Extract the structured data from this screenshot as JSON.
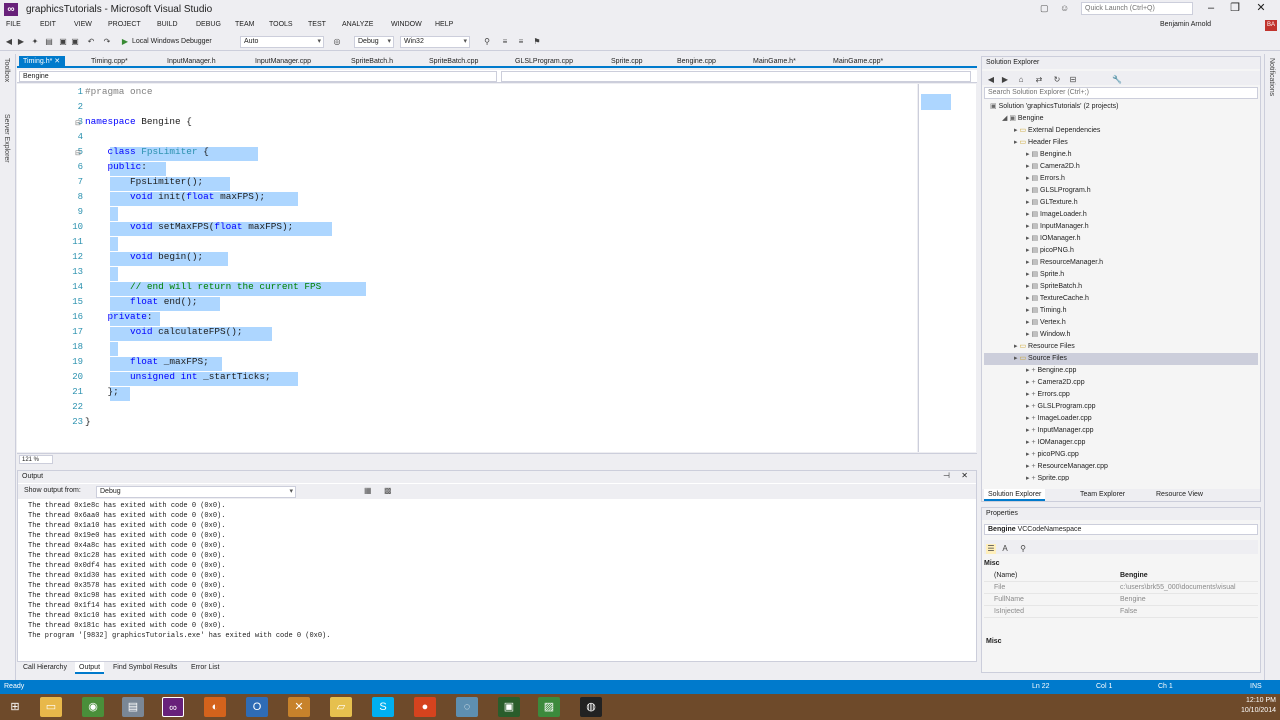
{
  "window": {
    "title": "graphicsTutorials - Microsoft Visual Studio",
    "quick_launch_placeholder": "Quick Launch (Ctrl+Q)",
    "user": "Benjamin Arnold",
    "avatar_initials": "BA"
  },
  "menu": [
    "FILE",
    "EDIT",
    "VIEW",
    "PROJECT",
    "BUILD",
    "DEBUG",
    "TEAM",
    "TOOLS",
    "TEST",
    "ANALYZE",
    "WINDOW",
    "HELP"
  ],
  "toolbar": {
    "debugger_label": "Local Windows Debugger",
    "debugger_mode": "Auto",
    "config": "Debug",
    "platform": "Win32"
  },
  "left_tabs": [
    "Toolbox",
    "Server Explorer"
  ],
  "right_tabs": [
    "Notifications"
  ],
  "doc_tabs": [
    "Timing.h*",
    "Timing.cpp*",
    "InputManager.h",
    "InputManager.cpp",
    "SpriteBatch.h",
    "SpriteBatch.cpp",
    "GLSLProgram.cpp",
    "Sprite.cpp",
    "Bengine.cpp",
    "MainGame.h*",
    "MainGame.cpp*"
  ],
  "nav": {
    "scope": "Bengine",
    "member": ""
  },
  "code_lines": [
    {
      "n": "1",
      "html": "<span class=\"pp\">#pragma once</span>"
    },
    {
      "n": "2",
      "html": ""
    },
    {
      "n": "3",
      "html": "<span class=\"kw\">namespace</span> Bengine {"
    },
    {
      "n": "4",
      "html": ""
    },
    {
      "n": "5",
      "html": "    <span class=\"kw\">class</span> <span class=\"ty\">FpsLimiter</span> {"
    },
    {
      "n": "6",
      "html": "    <span class=\"kw\">public</span>:"
    },
    {
      "n": "7",
      "html": "        FpsLimiter();"
    },
    {
      "n": "8",
      "html": "        <span class=\"kw\">void</span> init(<span class=\"kw\">float</span> maxFPS);"
    },
    {
      "n": "9",
      "html": ""
    },
    {
      "n": "10",
      "html": "        <span class=\"kw\">void</span> setMaxFPS(<span class=\"kw\">float</span> maxFPS);"
    },
    {
      "n": "11",
      "html": ""
    },
    {
      "n": "12",
      "html": "        <span class=\"kw\">void</span> begin();"
    },
    {
      "n": "13",
      "html": ""
    },
    {
      "n": "14",
      "html": "        <span class=\"cm\">// end will return the current FPS</span>"
    },
    {
      "n": "15",
      "html": "        <span class=\"kw\">float</span> end();"
    },
    {
      "n": "16",
      "html": "    <span class=\"kw\">private</span>:"
    },
    {
      "n": "17",
      "html": "        <span class=\"kw\">void</span> calculateFPS();"
    },
    {
      "n": "18",
      "html": ""
    },
    {
      "n": "19",
      "html": "        <span class=\"kw\">float</span> _maxFPS;"
    },
    {
      "n": "20",
      "html": "        <span class=\"kw\">unsigned int</span> _startTicks;"
    },
    {
      "n": "21",
      "html": "    };"
    },
    {
      "n": "22",
      "html": ""
    },
    {
      "n": "23",
      "html": "}"
    }
  ],
  "zoom": "121 %",
  "output": {
    "title": "Output",
    "show_from_label": "Show output from:",
    "show_from_value": "Debug",
    "lines": [
      "The thread 0x1e8c has exited with code 0 (0x0).",
      "The thread 0x6aa0 has exited with code 0 (0x0).",
      "The thread 0x1a10 has exited with code 0 (0x0).",
      "The thread 0x19e0 has exited with code 0 (0x0).",
      "The thread 0x4a8c has exited with code 0 (0x0).",
      "The thread 0x1c28 has exited with code 0 (0x0).",
      "The thread 0x0df4 has exited with code 0 (0x0).",
      "The thread 0x1d30 has exited with code 0 (0x0).",
      "The thread 0x3578 has exited with code 0 (0x0).",
      "The thread 0x1c98 has exited with code 0 (0x0).",
      "The thread 0x1f14 has exited with code 0 (0x0).",
      "The thread 0x1c10 has exited with code 0 (0x0).",
      "The thread 0x181c has exited with code 0 (0x0).",
      "The program '[9832] graphicsTutorials.exe' has exited with code 0 (0x0)."
    ]
  },
  "bottom_tabs": [
    "Call Hierarchy",
    "Output",
    "Find Symbol Results",
    "Error List"
  ],
  "solution_explorer": {
    "title": "Solution Explorer",
    "search_placeholder": "Search Solution Explorer (Ctrl+;)",
    "items": [
      {
        "label": "Solution 'graphicsTutorials' (2 projects)",
        "indent": 0
      },
      {
        "label": "Bengine",
        "indent": 1
      },
      {
        "label": "External Dependencies",
        "indent": 2
      },
      {
        "label": "Header Files",
        "indent": 2
      },
      {
        "label": "Bengine.h",
        "indent": 3
      },
      {
        "label": "Camera2D.h",
        "indent": 3
      },
      {
        "label": "Errors.h",
        "indent": 3
      },
      {
        "label": "GLSLProgram.h",
        "indent": 3
      },
      {
        "label": "GLTexture.h",
        "indent": 3
      },
      {
        "label": "ImageLoader.h",
        "indent": 3
      },
      {
        "label": "InputManager.h",
        "indent": 3
      },
      {
        "label": "IOManager.h",
        "indent": 3
      },
      {
        "label": "picoPNG.h",
        "indent": 3
      },
      {
        "label": "ResourceManager.h",
        "indent": 3
      },
      {
        "label": "Sprite.h",
        "indent": 3
      },
      {
        "label": "SpriteBatch.h",
        "indent": 3
      },
      {
        "label": "TextureCache.h",
        "indent": 3
      },
      {
        "label": "Timing.h",
        "indent": 3
      },
      {
        "label": "Vertex.h",
        "indent": 3
      },
      {
        "label": "Window.h",
        "indent": 3
      },
      {
        "label": "Resource Files",
        "indent": 2
      },
      {
        "label": "Source Files",
        "indent": 2
      },
      {
        "label": "Bengine.cpp",
        "indent": 3
      },
      {
        "label": "Camera2D.cpp",
        "indent": 3
      },
      {
        "label": "Errors.cpp",
        "indent": 3
      },
      {
        "label": "GLSLProgram.cpp",
        "indent": 3
      },
      {
        "label": "ImageLoader.cpp",
        "indent": 3
      },
      {
        "label": "InputManager.cpp",
        "indent": 3
      },
      {
        "label": "IOManager.cpp",
        "indent": 3
      },
      {
        "label": "picoPNG.cpp",
        "indent": 3
      },
      {
        "label": "ResourceManager.cpp",
        "indent": 3
      },
      {
        "label": "Sprite.cpp",
        "indent": 3
      }
    ],
    "tabs": [
      "Solution Explorer",
      "Team Explorer",
      "Resource View"
    ]
  },
  "properties": {
    "title": "Properties",
    "object": "Bengine",
    "object_type": "VCCodeNamespace",
    "category": "Misc",
    "rows": [
      {
        "k": "(Name)",
        "v": "Bengine"
      },
      {
        "k": "File",
        "v": "c:\\users\\brk55_000\\documents\\visual"
      },
      {
        "k": "FullName",
        "v": "Bengine"
      },
      {
        "k": "IsInjected",
        "v": "False"
      }
    ],
    "footer": "Misc"
  },
  "status": {
    "ready": "Ready",
    "ln": "Ln 22",
    "col": "Col 1",
    "ch": "Ch 1",
    "ins": "INS"
  },
  "taskbar": {
    "time": "12:10 PM",
    "date": "10/10/2014"
  }
}
